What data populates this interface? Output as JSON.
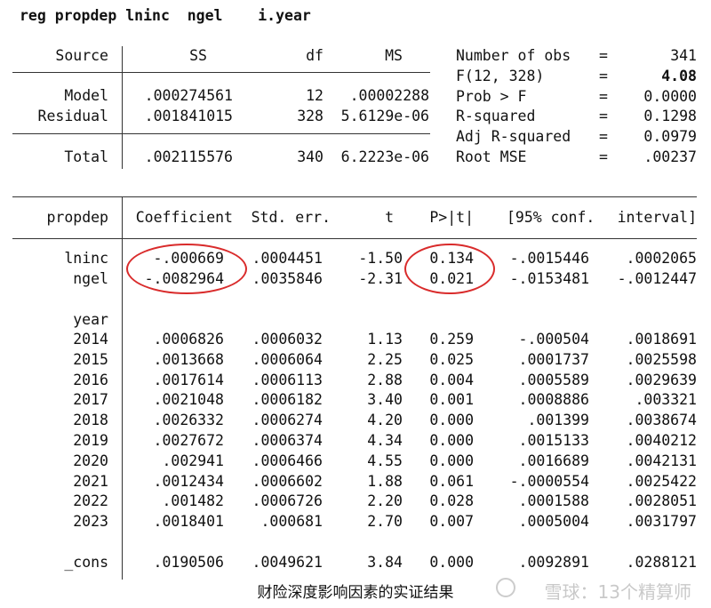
{
  "command": "reg propdep lninc  ngel    i.year",
  "anova": {
    "headers": [
      "Source",
      "SS",
      "df",
      "MS"
    ],
    "rows": [
      {
        "source": "Model",
        "ss": ".000274561",
        "df": "12",
        "ms": ".00002288"
      },
      {
        "source": "Residual",
        "ss": ".001841015",
        "df": "328",
        "ms": "5.6129e-06"
      }
    ],
    "total": {
      "source": "Total",
      "ss": ".002115576",
      "df": "340",
      "ms": "6.2223e-06"
    }
  },
  "stats": [
    {
      "label": "Number of obs",
      "eq": "=",
      "value": "341"
    },
    {
      "label": "F(12, 328)",
      "eq": "=",
      "value": "4.08"
    },
    {
      "label": "Prob > F",
      "eq": "=",
      "value": "0.0000"
    },
    {
      "label": "R-squared",
      "eq": "=",
      "value": "0.1298"
    },
    {
      "label": "Adj R-squared",
      "eq": "=",
      "value": "0.0979"
    },
    {
      "label": "Root MSE",
      "eq": "=",
      "value": ".00237"
    }
  ],
  "coef": {
    "headers": [
      "propdep",
      "Coefficient",
      "Std. err.",
      "t",
      "P>|t|",
      "[95% conf.",
      "interval]"
    ],
    "vars": [
      {
        "name": "lninc",
        "coef": "-.000669",
        "se": ".0004451",
        "t": "-1.50",
        "p": "0.134",
        "lo": "-.0015446",
        "hi": ".0002065"
      },
      {
        "name": "ngel",
        "coef": "-.0082964",
        "se": ".0035846",
        "t": "-2.31",
        "p": "0.021",
        "lo": "-.0153481",
        "hi": "-.0012447"
      }
    ],
    "group_label": "year",
    "years": [
      {
        "name": "2014",
        "coef": ".0006826",
        "se": ".0006032",
        "t": "1.13",
        "p": "0.259",
        "lo": "-.000504",
        "hi": ".0018691"
      },
      {
        "name": "2015",
        "coef": ".0013668",
        "se": ".0006064",
        "t": "2.25",
        "p": "0.025",
        "lo": ".0001737",
        "hi": ".0025598"
      },
      {
        "name": "2016",
        "coef": ".0017614",
        "se": ".0006113",
        "t": "2.88",
        "p": "0.004",
        "lo": ".0005589",
        "hi": ".0029639"
      },
      {
        "name": "2017",
        "coef": ".0021048",
        "se": ".0006182",
        "t": "3.40",
        "p": "0.001",
        "lo": ".0008886",
        "hi": ".003321"
      },
      {
        "name": "2018",
        "coef": ".0026332",
        "se": ".0006274",
        "t": "4.20",
        "p": "0.000",
        "lo": ".001399",
        "hi": ".0038674"
      },
      {
        "name": "2019",
        "coef": ".0027672",
        "se": ".0006374",
        "t": "4.34",
        "p": "0.000",
        "lo": ".0015133",
        "hi": ".0040212"
      },
      {
        "name": "2020",
        "coef": ".002941",
        "se": ".0006466",
        "t": "4.55",
        "p": "0.000",
        "lo": ".0016689",
        "hi": ".0042131"
      },
      {
        "name": "2021",
        "coef": ".0012434",
        "se": ".0006602",
        "t": "1.88",
        "p": "0.061",
        "lo": "-.0000554",
        "hi": ".0025422"
      },
      {
        "name": "2022",
        "coef": ".001482",
        "se": ".0006726",
        "t": "2.20",
        "p": "0.028",
        "lo": ".0001588",
        "hi": ".0028051"
      },
      {
        "name": "2023",
        "coef": ".0018401",
        "se": ".000681",
        "t": "2.70",
        "p": "0.007",
        "lo": ".0005004",
        "hi": ".0031797"
      }
    ],
    "cons": {
      "name": "_cons",
      "coef": ".0190506",
      "se": ".0049621",
      "t": "3.84",
      "p": "0.000",
      "lo": ".0092891",
      "hi": ".0288121"
    }
  },
  "caption": "财险深度影响因素的实证结果",
  "watermark": "雪球：13个精算师",
  "colors": {
    "highlight": "#d92b2b",
    "text": "#111111",
    "rule": "#333333"
  }
}
